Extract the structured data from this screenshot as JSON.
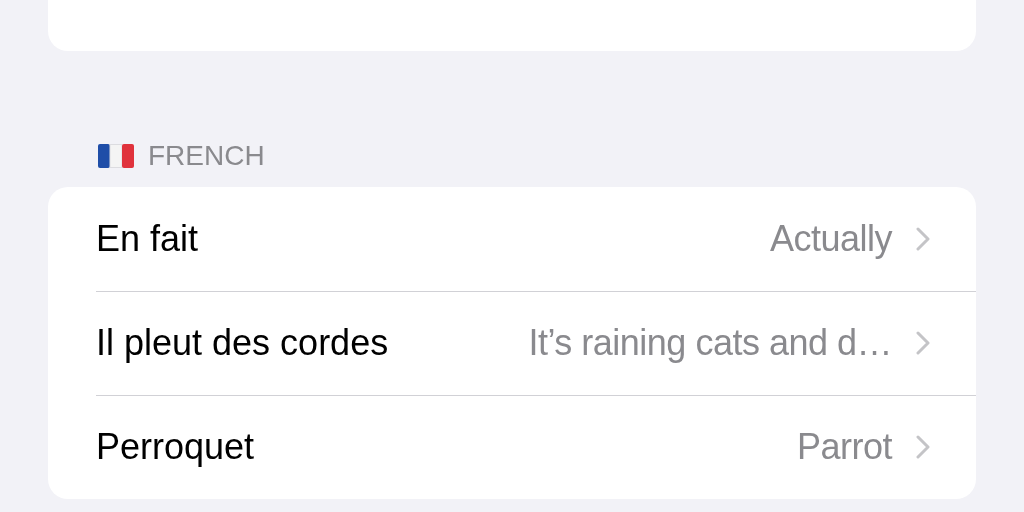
{
  "sections": [
    {
      "header": "FRENCH",
      "rows": [
        {
          "label": "En fait",
          "value": "Actually"
        },
        {
          "label": "Il pleut des cordes",
          "value": "It’s raining cats and d…"
        },
        {
          "label": "Perroquet",
          "value": "Parrot"
        }
      ]
    }
  ]
}
